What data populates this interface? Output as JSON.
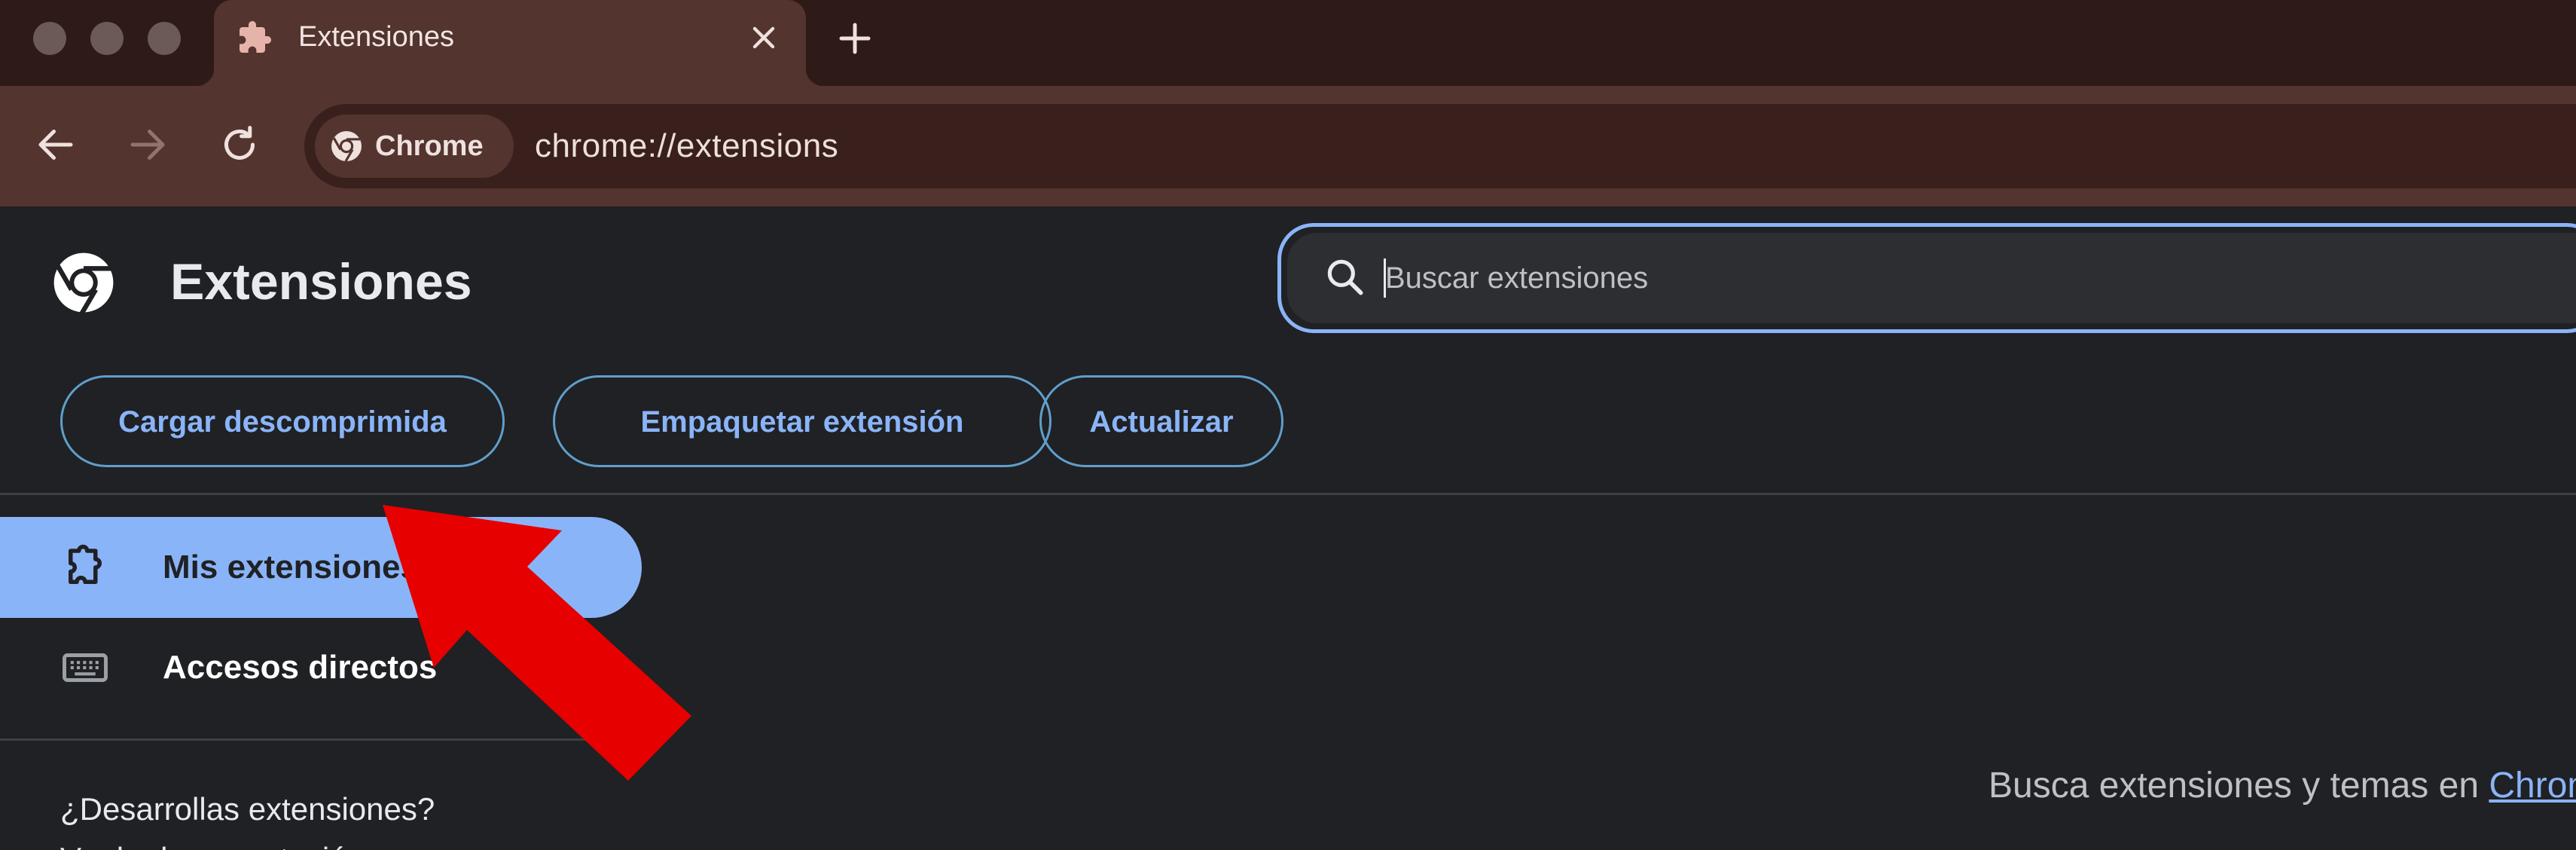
{
  "window": {
    "tab": {
      "title": "Extensiones",
      "favicon": "puzzle-icon"
    },
    "new_tab_icon": "plus-icon"
  },
  "toolbar": {
    "chip_label": "Chrome",
    "url": "chrome://extensions"
  },
  "page": {
    "title": "Extensiones",
    "search": {
      "placeholder": "Buscar extensiones",
      "value": ""
    },
    "actions": [
      {
        "label": "Cargar descomprimida"
      },
      {
        "label": "Empaquetar extensión"
      },
      {
        "label": "Actualizar"
      }
    ],
    "sidebar": {
      "items": [
        {
          "label": "Mis extensiones",
          "icon": "extension-icon",
          "active": true
        },
        {
          "label": "Accesos directos",
          "icon": "keyboard-icon",
          "active": false
        }
      ],
      "dev_text": "¿Desarrollas extensiones?",
      "dev_text_partial": "Ver la documentación"
    },
    "store_text": "Busca extensiones y temas en ",
    "store_link": "Chrome Web Store"
  },
  "annotation": {
    "type": "arrow",
    "color": "#e60000"
  },
  "colors": {
    "tabstrip": "#2e1a17",
    "toolbar": "#53342f",
    "page_bg": "#202124",
    "accent": "#8ab4f8"
  }
}
